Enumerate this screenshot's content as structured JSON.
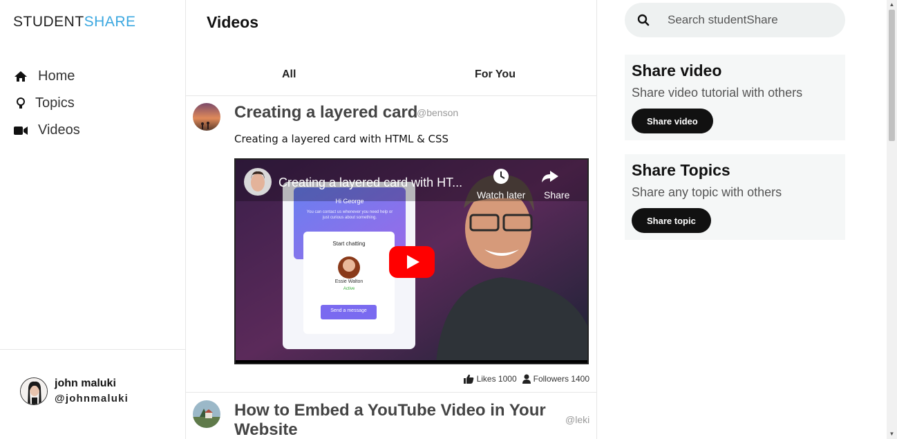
{
  "brand": {
    "part1": "STUDENT",
    "part2": "SHARE"
  },
  "nav": [
    {
      "label": "Home",
      "icon": "home-icon"
    },
    {
      "label": "Topics",
      "icon": "lightbulb-icon"
    },
    {
      "label": "Videos",
      "icon": "video-camera-icon"
    }
  ],
  "user": {
    "name": "john maluki",
    "handle": "@johnmaluki"
  },
  "main": {
    "title": "Videos",
    "tabs": [
      "All",
      "For You"
    ],
    "posts": [
      {
        "title": "Creating a layered card",
        "handle": "@benson",
        "description": "Creating a layered card with HTML & CSS",
        "video": {
          "title": "Creating a layered card with HT...",
          "watch_later": "Watch later",
          "share": "Share",
          "card_greeting": "Hi George",
          "card_text": "You can contact us whenever you need help or just curious about something.",
          "chat_label": "Start chatting",
          "contact_name": "Essie Walton",
          "contact_status": "Active",
          "send_label": "Send a message"
        },
        "likes": "Likes 1000",
        "followers": "Followers 1400"
      },
      {
        "title_line1": "How to Embed a YouTube Video in Your",
        "title_line2": "Website",
        "handle": "@leki"
      }
    ]
  },
  "search": {
    "placeholder": "Search studentShare"
  },
  "cards": [
    {
      "title": "Share video",
      "text": "Share video tutorial with others",
      "button": "Share video"
    },
    {
      "title": "Share Topics",
      "text": "Share any topic with others",
      "button": "Share topic"
    }
  ],
  "colors": {
    "brand_accent": "#3aa7e0",
    "button_bg": "#111111",
    "card_bg": "#f5f7f7",
    "youtube_red": "#ff0000"
  }
}
